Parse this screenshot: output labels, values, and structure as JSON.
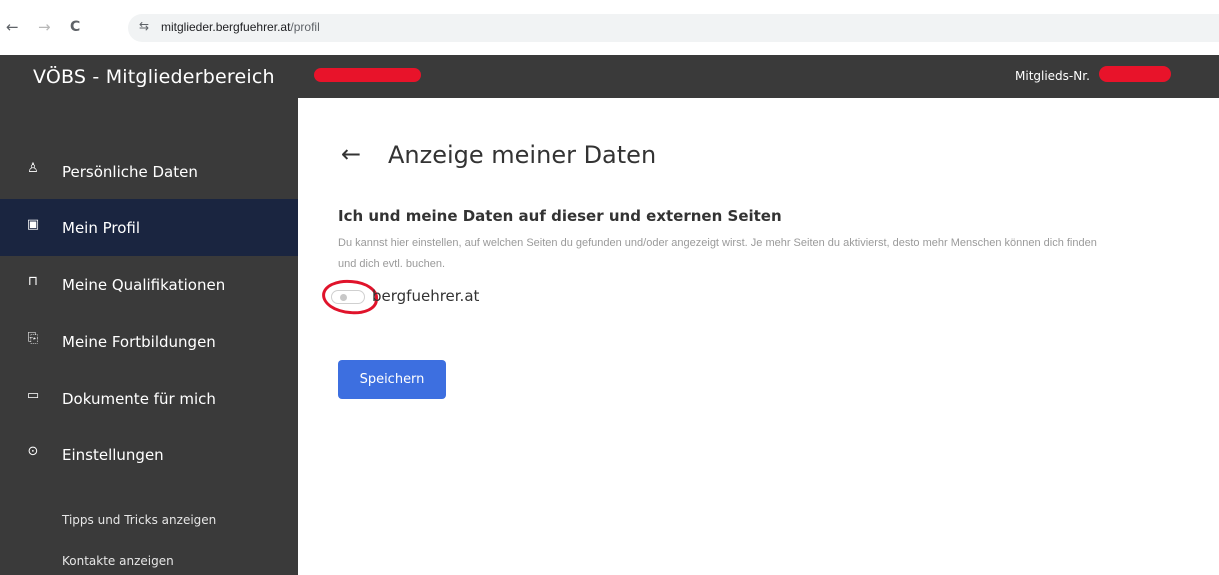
{
  "browser": {
    "back_icon": "←",
    "forward_icon": "→",
    "reload_icon": "C",
    "site_settings_icon": "⇆",
    "url_domain": "mitglieder.bergfuehrer.at",
    "url_path": "/profil"
  },
  "header": {
    "title": "VÖBS - Mitgliederbereich",
    "member_number_label": "Mitglieds-Nr."
  },
  "sidebar": {
    "items": [
      {
        "label": "Persönliche Daten",
        "icon": "person-icon",
        "glyph": "♙"
      },
      {
        "label": "Mein Profil",
        "icon": "id-card-icon",
        "glyph": "▣"
      },
      {
        "label": "Meine Qualifikationen",
        "icon": "bookmark-icon",
        "glyph": "⊓"
      },
      {
        "label": "Meine Fortbildungen",
        "icon": "file-arrow-icon",
        "glyph": "⎘"
      },
      {
        "label": "Dokumente für mich",
        "icon": "folder-icon",
        "glyph": "▭"
      },
      {
        "label": "Einstellungen",
        "icon": "gear-icon",
        "glyph": "⊙"
      }
    ],
    "links": [
      {
        "label": "Tipps und Tricks anzeigen"
      },
      {
        "label": "Kontakte anzeigen"
      }
    ]
  },
  "main": {
    "back_glyph": "←",
    "page_title": "Anzeige meiner Daten",
    "section_title": "Ich und meine Daten auf dieser und externen Seiten",
    "section_description": "Du kannst hier einstellen, auf welchen Seiten du gefunden und/oder angezeigt wirst. Je mehr Seiten du aktivierst, desto mehr Menschen können dich finden und dich evtl. buchen.",
    "toggle_site_label": "bergfuehrer.at",
    "toggle_on": false,
    "save_label": "Speichern"
  },
  "colors": {
    "header_bg": "#3a3a3a",
    "sidebar_active_bg": "#1a2540",
    "primary_button": "#3d6fe0",
    "redaction": "#e8132a"
  }
}
